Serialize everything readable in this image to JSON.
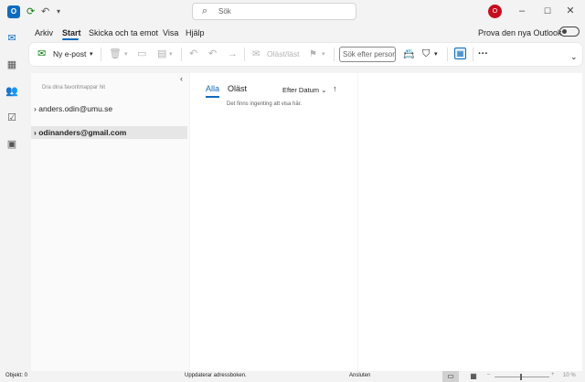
{
  "titlebar": {
    "app_icon": "outlook-icon",
    "search_placeholder": "Sök",
    "avatar_initial": "O",
    "accent_color": "#0f6cbd",
    "avatar_color": "#c50f1f"
  },
  "menu": {
    "tabs": [
      "Arkiv",
      "Start",
      "Skicka och ta emot",
      "Visa",
      "Hjälp"
    ],
    "active_tab": "Start",
    "try_new_label": "Prova den nya Outlook"
  },
  "ribbon": {
    "new_mail": "Ny e-post",
    "read_unread": "Oläst/läst",
    "search_people_placeholder": "Sök efter personer",
    "more": "···"
  },
  "folder_pane": {
    "favorites_hint": "Dra dina favoritmappar hit",
    "accounts": [
      "anders.odin@umu.se",
      "odinanders@gmail.com"
    ]
  },
  "message_list": {
    "tab_all": "Alla",
    "tab_unread": "Oläst",
    "sort_label": "Efter Datum",
    "empty_text": "Det finns ingenting att visa här."
  },
  "status": {
    "items": "Objekt: 0",
    "updating": "Uppdaterar adressboken.",
    "connection": "Ansluten",
    "zoom": "10 %"
  }
}
